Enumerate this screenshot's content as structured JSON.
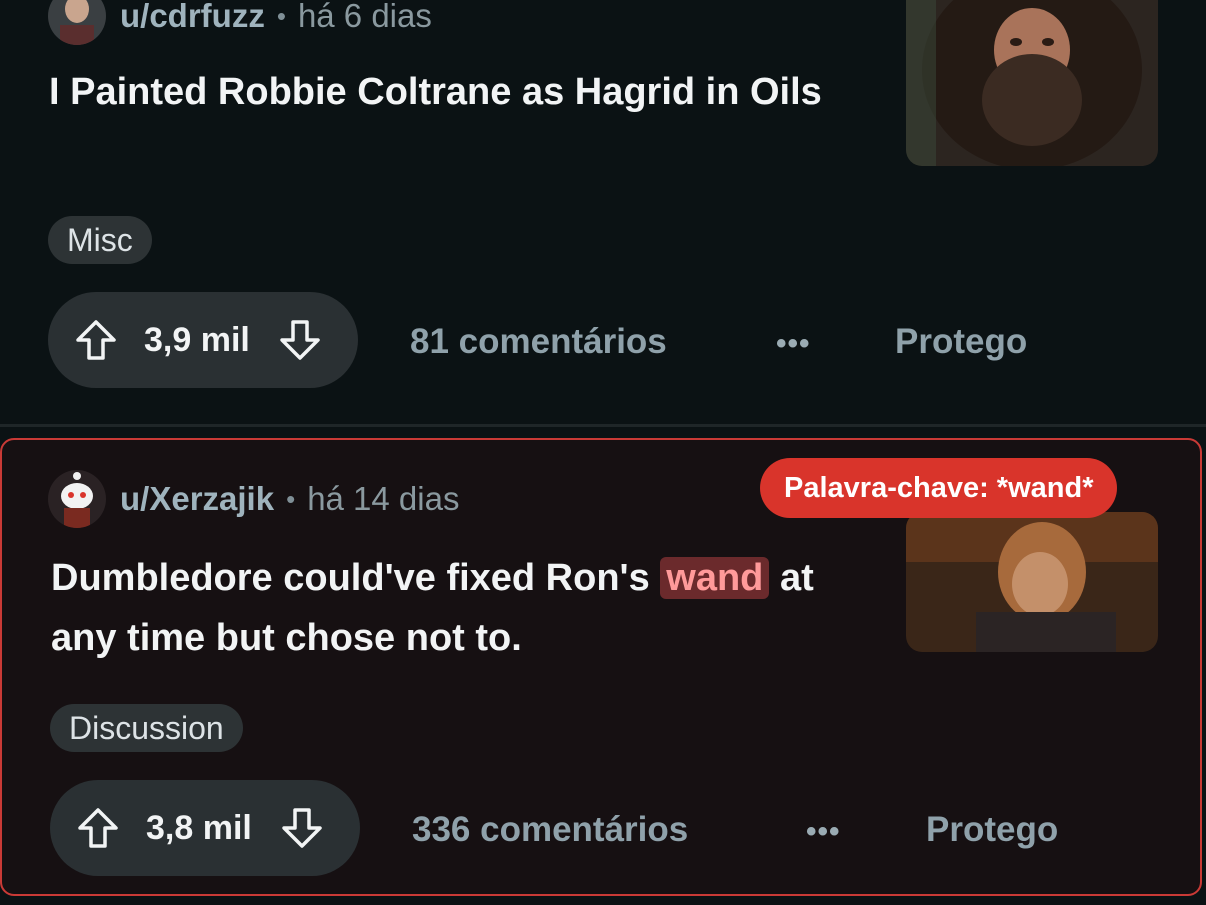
{
  "posts": [
    {
      "username": "u/cdrfuzz",
      "time": "há 6 dias",
      "title": "I Painted Robbie Coltrane as Hagrid in Oils",
      "flair": "Misc",
      "score": "3,9 mil",
      "comments": "81 comentários",
      "more": "•••",
      "award": "Protego"
    },
    {
      "username": "u/Xerzajik",
      "time": "há 14 dias",
      "title_before": "Dumbledore could've fixed Ron's ",
      "title_highlight": "wand",
      "title_after": " at any time but chose not to.",
      "flair": "Discussion",
      "score": "3,8 mil",
      "comments": "336 comentários",
      "more": "•••",
      "award": "Protego",
      "keyword_badge": "Palavra-chave: *wand*"
    }
  ],
  "colors": {
    "highlight_border": "#c93a36",
    "keyword_badge": "#d9342b"
  },
  "icons": [
    "upvote-arrow-icon",
    "downvote-arrow-icon",
    "avatar-icon"
  ]
}
